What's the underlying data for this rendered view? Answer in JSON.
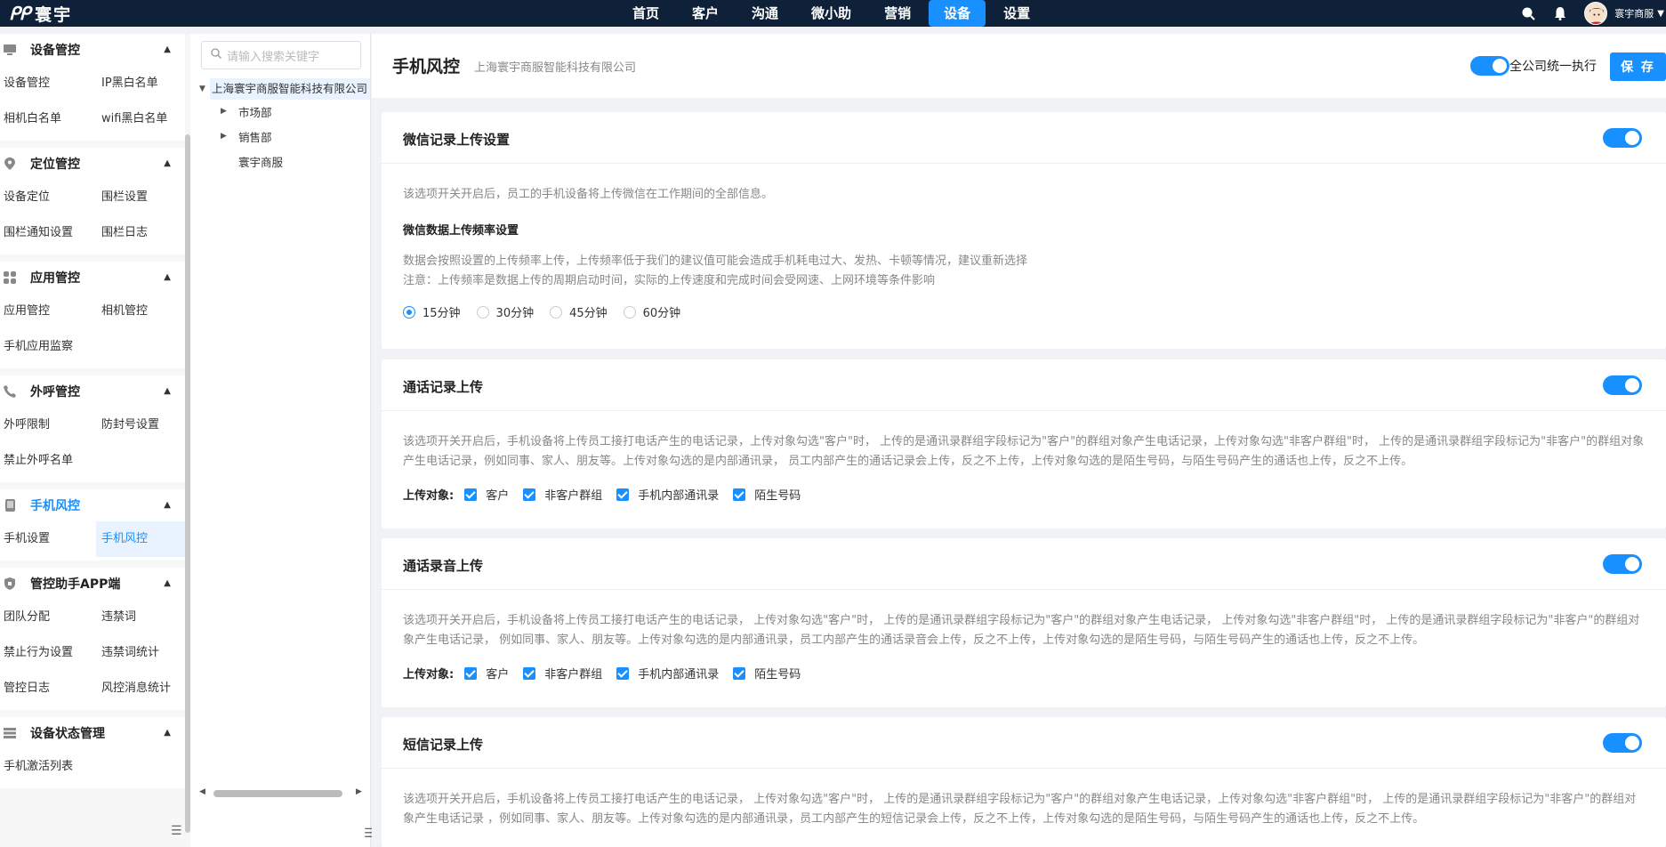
{
  "app": {
    "logo_mark": "ᑭᑭ",
    "logo_text": "寰宇"
  },
  "nav": {
    "items": [
      "首页",
      "客户",
      "沟通",
      "微小助",
      "营销",
      "设备",
      "设置"
    ],
    "active_index": 5
  },
  "user": {
    "name": "寰宇商服"
  },
  "sidebar": {
    "groups": [
      {
        "title": "设备管控",
        "icon": "device-icon",
        "items": [
          "设备管控",
          "IP黑白名单",
          "相机白名单",
          "wifi黑白名单"
        ]
      },
      {
        "title": "定位管控",
        "icon": "location-icon",
        "items": [
          "设备定位",
          "围栏设置",
          "围栏通知设置",
          "围栏日志"
        ]
      },
      {
        "title": "应用管控",
        "icon": "apps-icon",
        "items": [
          "应用管控",
          "相机管控",
          "手机应用监察"
        ]
      },
      {
        "title": "外呼管控",
        "icon": "phone-icon",
        "items": [
          "外呼限制",
          "防封号设置",
          "禁止外呼名单"
        ]
      },
      {
        "title": "手机风控",
        "icon": "phone-risk-icon",
        "items": [
          "手机设置",
          "手机风控"
        ],
        "active": true,
        "active_item": 1
      },
      {
        "title": "管控助手APP端",
        "icon": "shield-icon",
        "items": [
          "团队分配",
          "违禁词",
          "禁止行为设置",
          "违禁词统计",
          "管控日志",
          "风控消息统计"
        ]
      },
      {
        "title": "设备状态管理",
        "icon": "status-icon",
        "items": [
          "手机激活列表"
        ]
      }
    ]
  },
  "tree": {
    "search_placeholder": "请输入搜索关键字",
    "root": "上海寰宇商服智能科技有限公司",
    "children": [
      "市场部",
      "销售部",
      "寰宇商服"
    ]
  },
  "page": {
    "title": "手机风控",
    "subtitle": "上海寰宇商服智能科技有限公司",
    "unify_label": "全公司统一执行",
    "save_label": "保 存"
  },
  "cards": {
    "wechat": {
      "title": "微信记录上传设置",
      "enabled": true,
      "desc": "该选项开关开启后，员工的手机设备将上传微信在工作期间的全部信息。",
      "freq_title": "微信数据上传频率设置",
      "freq_desc1": "数据会按照设置的上传频率上传，上传频率低于我们的建议值可能会造成手机耗电过大、发热、卡顿等情况，建议重新选择",
      "freq_desc2": "注意：上传频率是数据上传的周期启动时间，实际的上传速度和完成时间会受网速、上网环境等条件影响",
      "freq_options": [
        "15分钟",
        "30分钟",
        "45分钟",
        "60分钟"
      ],
      "freq_selected": 0
    },
    "call_log": {
      "title": "通话记录上传",
      "enabled": true,
      "desc": "该选项开关开启后，手机设备将上传员工接打电话产生的电话记录，上传对象勾选\"客户\"时， 上传的是通讯录群组字段标记为\"客户\"的群组对象产生电话记录，上传对象勾选\"非客户群组\"时， 上传的是通讯录群组字段标记为\"非客户\"的群组对象产生电话记录，例如同事、家人、朋友等。上传对象勾选的是内部通讯录， 员工内部产生的通话记录会上传，反之不上传，上传对象勾选的是陌生号码，与陌生号码产生的通话也上传，反之不上传。",
      "targets_label": "上传对象:",
      "targets": [
        "客户",
        "非客户群组",
        "手机内部通讯录",
        "陌生号码"
      ]
    },
    "call_recording": {
      "title": "通话录音上传",
      "enabled": true,
      "desc": "该选项开关开启后，手机设备将上传员工接打电话产生的电话记录， 上传对象勾选\"客户\"时， 上传的是通讯录群组字段标记为\"客户\"的群组对象产生电话记录， 上传对象勾选\"非客户群组\"时， 上传的是通讯录群组字段标记为\"非客户\"的群组对象产生电话记录， 例如同事、家人、朋友等。上传对象勾选的是内部通讯录，员工内部产生的通话录音会上传，反之不上传，上传对象勾选的是陌生号码，与陌生号码产生的通话也上传，反之不上传。",
      "targets_label": "上传对象:",
      "targets": [
        "客户",
        "非客户群组",
        "手机内部通讯录",
        "陌生号码"
      ]
    },
    "sms": {
      "title": "短信记录上传",
      "enabled": true,
      "desc": "该选项开关开启后，手机设备将上传员工接打电话产生的电话记录， 上传对象勾选\"客户\"时， 上传的是通讯录群组字段标记为\"客户\"的群组对象产生电话记录，上传对象勾选\"非客户群组\"时， 上传的是通讯录群组字段标记为\"非客户\"的群组对象产生电话记录 ，例如同事、家人、朋友等。上传对象勾选的是内部通讯录，员工内部产生的短信记录会上传，反之不上传，上传对象勾选的是陌生号码，与陌生号码产生的通话也上传，反之不上传。"
    }
  },
  "colors": {
    "nav_bg": "#0f2138",
    "accent": "#1890ff"
  }
}
